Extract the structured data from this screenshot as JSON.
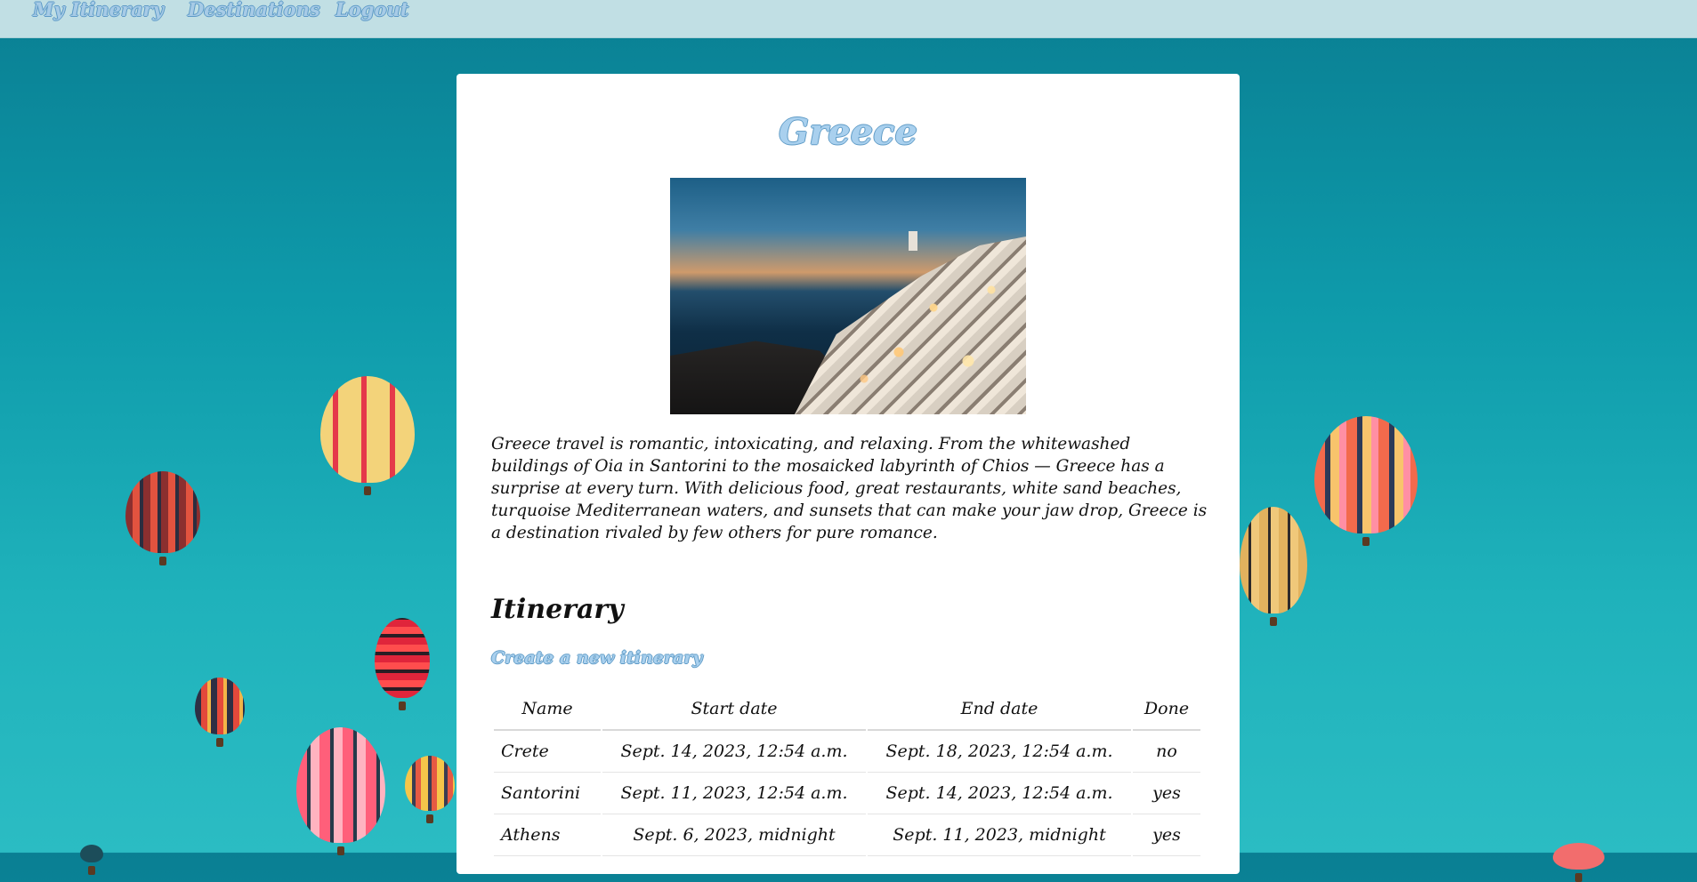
{
  "nav": {
    "items": [
      {
        "label": "My Itinerary"
      },
      {
        "label": "Destinations"
      },
      {
        "label": "Logout"
      }
    ]
  },
  "destination": {
    "title": "Greece",
    "description": "Greece travel is romantic, intoxicating, and relaxing. From the whitewashed buildings of Oia in Santorini to the mosaicked labyrinth of Chios — Greece has a surprise at every turn. With delicious food, great restaurants, white sand beaches, turquoise Mediterranean waters, and sunsets that can make your jaw drop, Greece is a destination rivaled by few others for pure romance."
  },
  "itinerary": {
    "heading": "Itinerary",
    "create_link": "Create a new itinerary",
    "columns": [
      "Name",
      "Start date",
      "End date",
      "Done"
    ],
    "rows": [
      {
        "name": "Crete",
        "start": "Sept. 14, 2023, 12:54 a.m.",
        "end": "Sept. 18, 2023, 12:54 a.m.",
        "done": "no"
      },
      {
        "name": "Santorini",
        "start": "Sept. 11, 2023, 12:54 a.m.",
        "end": "Sept. 14, 2023, 12:54 a.m.",
        "done": "yes"
      },
      {
        "name": "Athens",
        "start": "Sept. 6, 2023, midnight",
        "end": "Sept. 11, 2023, midnight",
        "done": "yes"
      }
    ]
  },
  "colors": {
    "nav_bg": "#c1dfe4",
    "link_fill": "#a9d0ee",
    "link_outline": "#5f9bc6",
    "page_bg": "#0e9aaa"
  }
}
